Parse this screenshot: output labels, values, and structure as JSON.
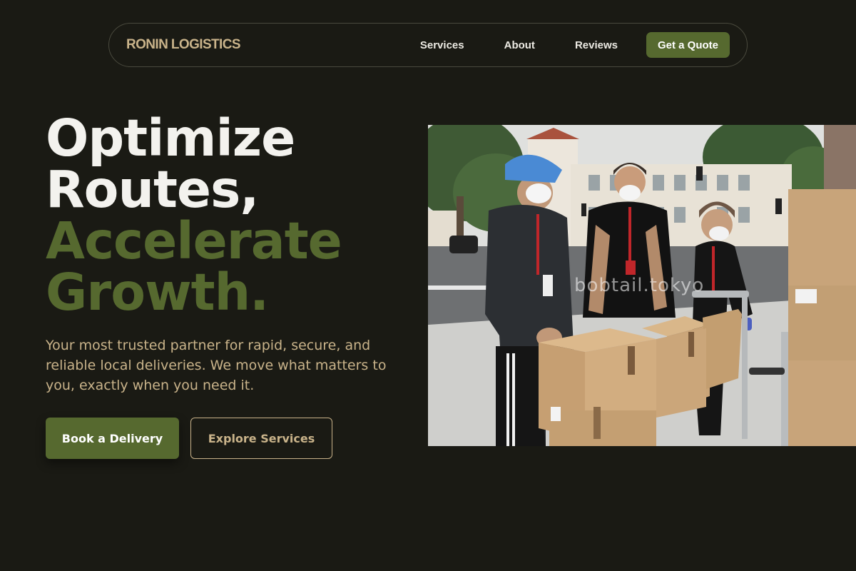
{
  "nav": {
    "brand": "RONIN LOGISTICS",
    "links": [
      "Services",
      "About",
      "Reviews"
    ],
    "cta": "Get a Quote"
  },
  "hero": {
    "headline": {
      "line1": "Optimize",
      "line2": "Routes,",
      "line3": "Accelerate",
      "line4": "Growth."
    },
    "subtext": "Your most trusted partner for rapid, secure, and reliable local deliveries. We move what matters to you, exactly when you need it.",
    "primary_button": "Book a Delivery",
    "secondary_button": "Explore Services",
    "image_watermark": "bobtail.tokyo"
  },
  "colors": {
    "background": "#1a1a14",
    "accent_green": "#56692f",
    "accent_tan": "#c9b38a",
    "text_light": "#f3f2ee"
  }
}
